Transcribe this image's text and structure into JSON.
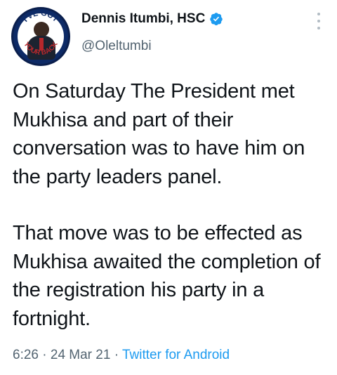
{
  "author": {
    "display_name": "Dennis Itumbi, HSC",
    "handle": "@Oleltumbi",
    "avatar_text_top": "I'VE GOT",
    "avatar_text_bottom": "YOUR BACK",
    "verified_icon": "verified-badge-icon"
  },
  "tweet": {
    "paragraphs": [
      "On Saturday The President met Mukhisa and part of their conversation was to have him on the party leaders panel.",
      "That move was to be effected as Mukhisa awaited the completion of the registration his party in a fortnight."
    ]
  },
  "meta": {
    "time": "6:26",
    "separator": " · ",
    "date": "24 Mar 21",
    "separator2": " · ",
    "source": "Twitter for Android"
  },
  "colors": {
    "accent": "#1d9bf0",
    "secondary_text": "#536471",
    "primary_text": "#0f1419"
  }
}
